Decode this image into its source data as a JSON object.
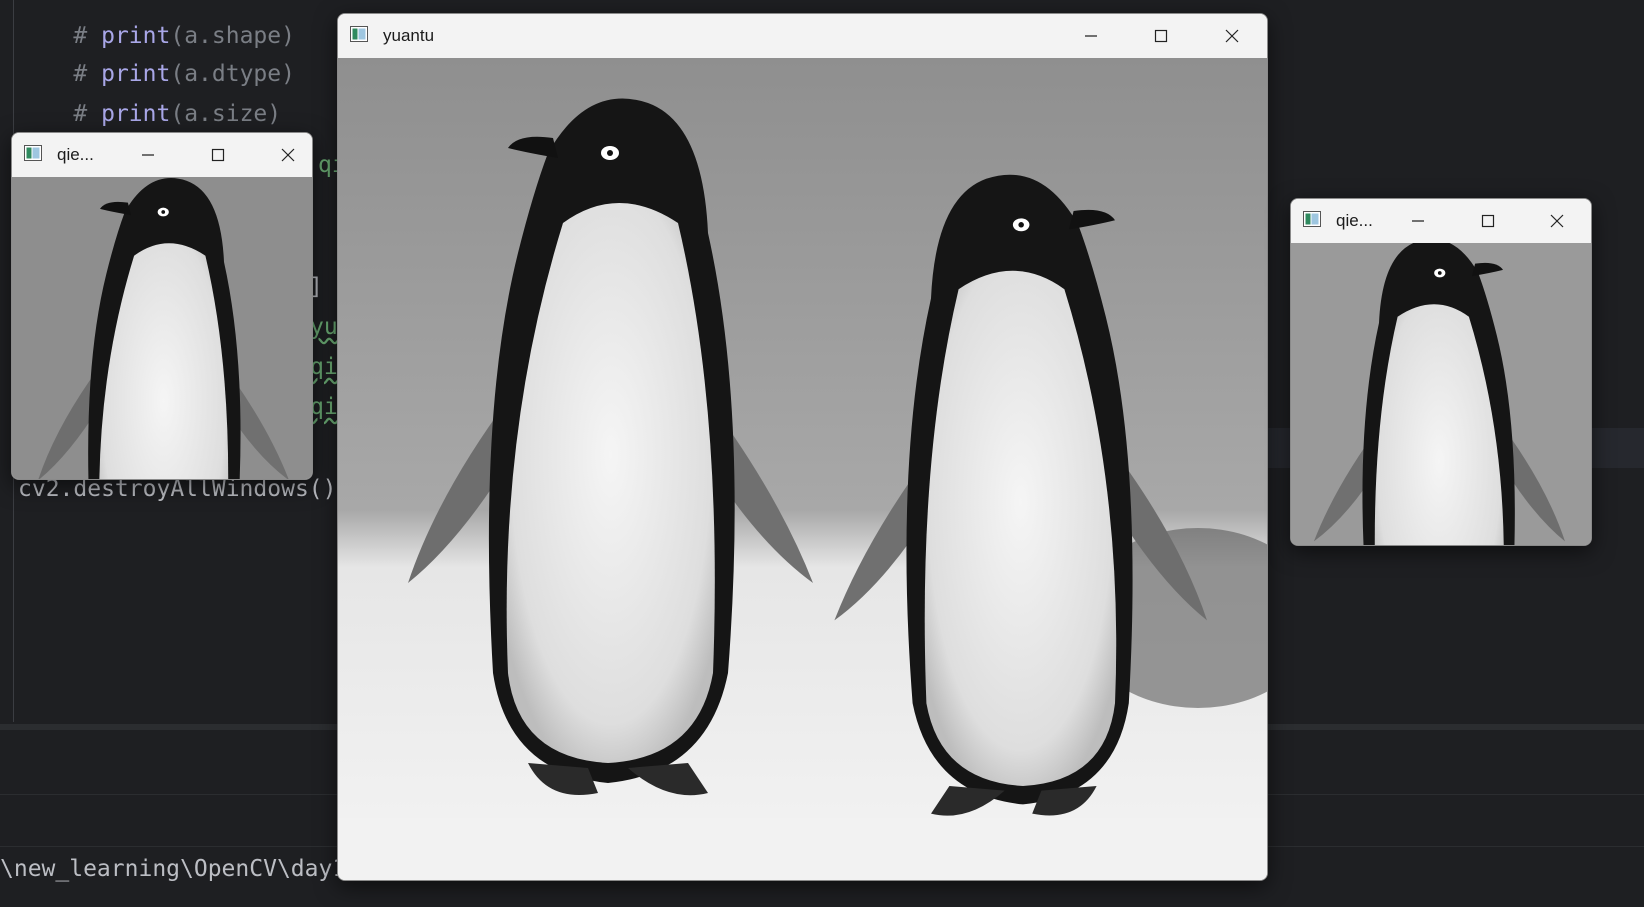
{
  "editor": {
    "lines": [
      {
        "comment": "# ",
        "fn": "print",
        "args": "(a.shape)"
      },
      {
        "comment": "# ",
        "fn": "print",
        "args": "(a.dtype)"
      },
      {
        "comment": "# ",
        "fn": "print",
        "args": "(a.size)"
      }
    ],
    "fragments": {
      "frag1": "qi",
      "bracket": "]",
      "frag2": "yu",
      "frag3": "qi",
      "frag4": "qi"
    },
    "destroy_line": "cv2.destroyAllWindows()"
  },
  "terminal": {
    "path_line": "\\new_learning\\OpenCV\\day1"
  },
  "windows": {
    "left": {
      "title": "qie..."
    },
    "main": {
      "title": "yuantu"
    },
    "right": {
      "title": "qie..."
    }
  },
  "colors": {
    "ide_background": "#1e1f22",
    "titlebar": "#f3f3f3",
    "comment": "#7a7e85",
    "function": "#a9a7e8",
    "string": "#6aab73"
  },
  "icons": [
    "app-icon",
    "minimize-icon",
    "maximize-icon",
    "close-icon"
  ]
}
